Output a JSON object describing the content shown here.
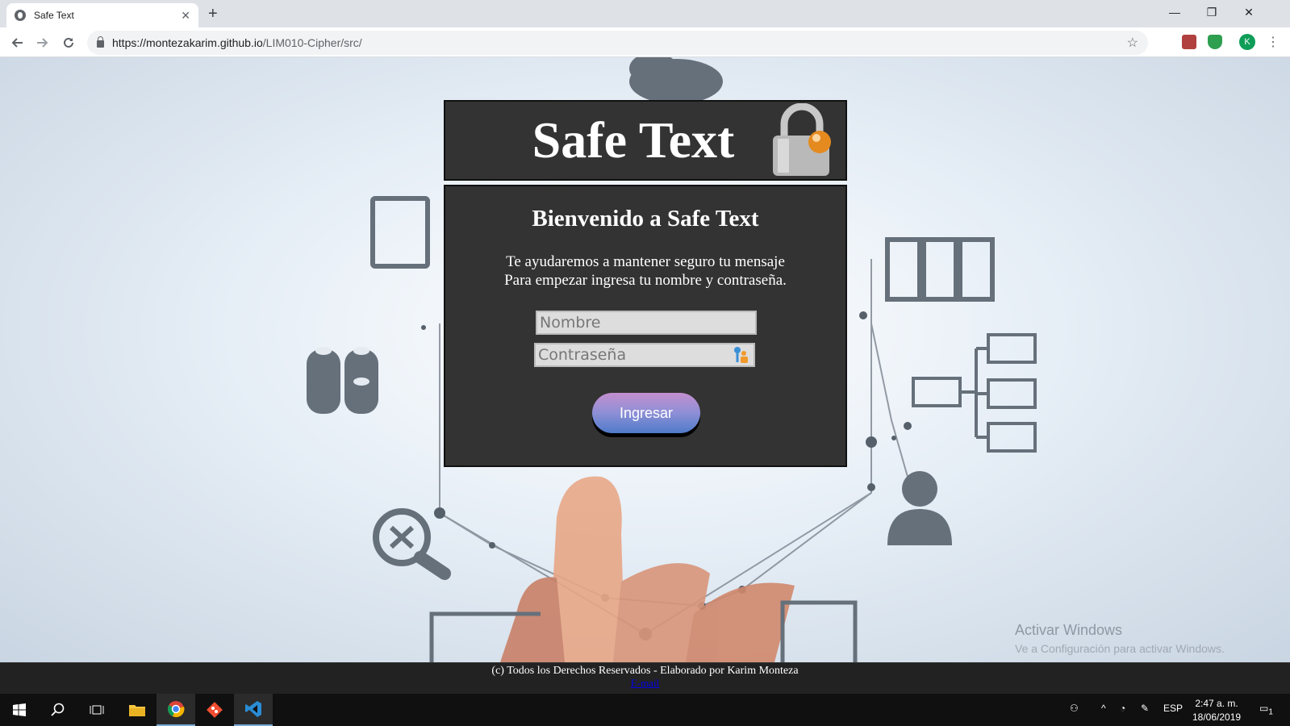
{
  "browser": {
    "tab_title": "Safe Text",
    "url_host": "https://montezakarim.github.io",
    "url_path": "/LIM010-Cipher/src/",
    "avatar_initial": "K",
    "window_controls": {
      "minimize": "—",
      "restore": "❐",
      "close": "✕"
    },
    "icons": [
      "back-icon",
      "forward-icon",
      "reload-icon",
      "lock-icon",
      "star-icon",
      "pdf-extension-icon",
      "shield-extension-icon",
      "menu-icon"
    ]
  },
  "page": {
    "header_title": "Safe Text",
    "welcome": "Bienvenido a Safe Text",
    "intro_line1": "Te ayudaremos a mantener seguro tu mensaje",
    "intro_line2": "Para empezar ingresa tu nombre y contraseña.",
    "name_placeholder": "Nombre",
    "password_placeholder": "Contraseña",
    "submit_label": "Ingresar",
    "footer_text": "(c) Todos los Derechos Reservados - Elaborado por Karim Monteza",
    "footer_link": "E-mail",
    "colors": {
      "panel": "#333333",
      "button_top": "#c48fcf",
      "button_bottom": "#4f7bc9"
    }
  },
  "watermark": {
    "title": "Activar Windows",
    "subtitle": "Ve a Configuración para activar Windows."
  },
  "taskbar": {
    "language": "ESP",
    "time": "2:47 a. m.",
    "date": "18/06/2019",
    "notification_count": "1",
    "icons": [
      "windows-start-icon",
      "search-icon",
      "task-view-icon",
      "file-explorer-icon",
      "chrome-icon",
      "git-icon",
      "vscode-icon"
    ]
  }
}
